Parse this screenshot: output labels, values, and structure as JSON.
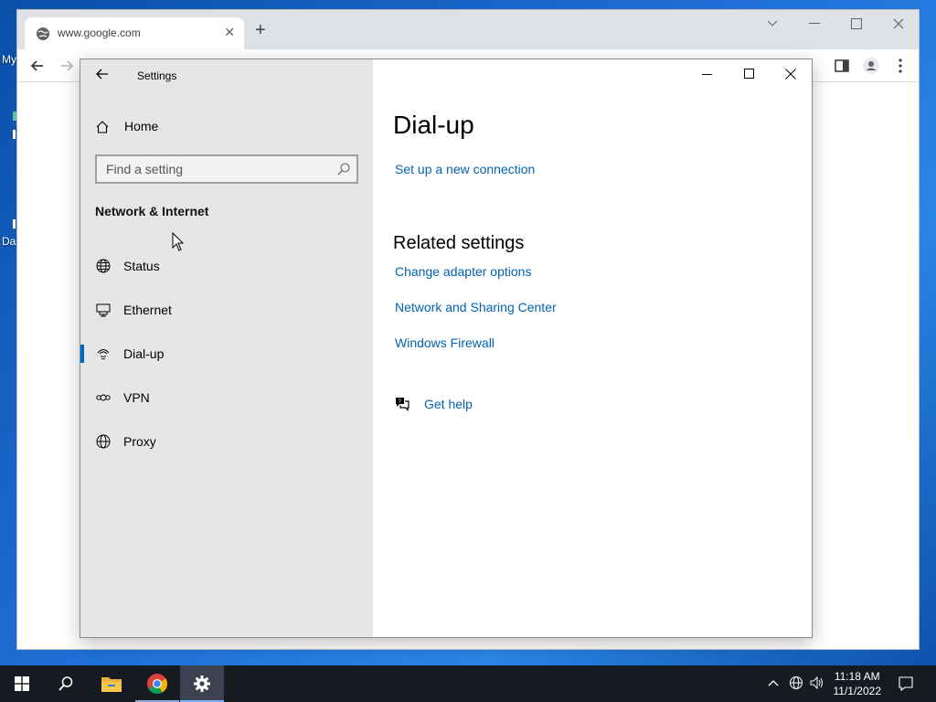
{
  "desktop": {
    "labels": [
      "My",
      "Da"
    ]
  },
  "browser": {
    "tab_title": "www.google.com",
    "tab_close": "✕",
    "new_tab": "+"
  },
  "settings": {
    "window_title": "Settings",
    "home_label": "Home",
    "search_placeholder": "Find a setting",
    "category": "Network & Internet",
    "nav": [
      {
        "label": "Status",
        "icon": "status-globe-icon"
      },
      {
        "label": "Ethernet",
        "icon": "ethernet-icon"
      },
      {
        "label": "Dial-up",
        "icon": "dialup-icon",
        "selected": true
      },
      {
        "label": "VPN",
        "icon": "vpn-icon"
      },
      {
        "label": "Proxy",
        "icon": "proxy-globe-icon"
      }
    ],
    "page_title": "Dial-up",
    "setup_link": "Set up a new connection",
    "related_heading": "Related settings",
    "related_links": [
      "Change adapter options",
      "Network and Sharing Center",
      "Windows Firewall"
    ],
    "help_link": "Get help",
    "accent_color": "#0067c0"
  },
  "taskbar": {
    "time": "11:18 AM",
    "date": "11/1/2022"
  }
}
